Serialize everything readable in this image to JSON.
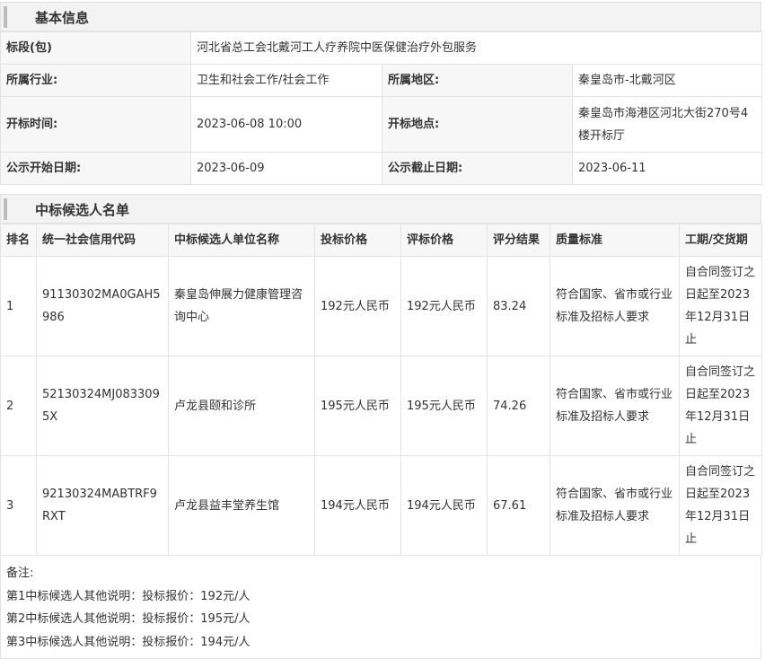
{
  "basic": {
    "title": "基本信息",
    "section_label": "标段(包)",
    "section_value": "河北省总工会北戴河工人疗养院中医保健治疗外包服务",
    "industry_label": "所属行业:",
    "industry_value": "卫生和社会工作/社会工作",
    "region_label": "所属地区:",
    "region_value": "秦皇岛市-北戴河区",
    "open_time_label": "开标时间:",
    "open_time_value": "2023-06-08 10:00",
    "open_place_label": "开标地点:",
    "open_place_value": "秦皇岛市海港区河北大街270号4楼开标厅",
    "pub_start_label": "公示开始日期:",
    "pub_start_value": "2023-06-09",
    "pub_end_label": "公示截止日期:",
    "pub_end_value": "2023-06-11"
  },
  "candidates": {
    "title": "中标候选人名单",
    "headers": {
      "rank": "排名",
      "code": "统一社会信用代码",
      "name": "中标候选人单位名称",
      "bid": "投标价格",
      "eval": "评标价格",
      "score": "评分结果",
      "quality": "质量标准",
      "period": "工期/交货期"
    },
    "rows": [
      {
        "rank": "1",
        "code": "91130302MA0GAH5986",
        "name": "秦皇岛伸展力健康管理咨询中心",
        "bid": "192元人民币",
        "eval": "192元人民币",
        "score": "83.24",
        "quality": "符合国家、省市或行业标准及招标人要求",
        "period": "自合同签订之日起至2023年12月31日止"
      },
      {
        "rank": "2",
        "code": "52130324MJ0833095X",
        "name": "卢龙县颐和诊所",
        "bid": "195元人民币",
        "eval": "195元人民币",
        "score": "74.26",
        "quality": "符合国家、省市或行业标准及招标人要求",
        "period": "自合同签订之日起至2023年12月31日止"
      },
      {
        "rank": "3",
        "code": "92130324MABTRF9RXT",
        "name": "卢龙县益丰堂养生馆",
        "bid": "194元人民币",
        "eval": "194元人民币",
        "score": "67.61",
        "quality": "符合国家、省市或行业标准及招标人要求",
        "period": "自合同签订之日起至2023年12月31日止"
      }
    ]
  },
  "notes": {
    "label": "备注:",
    "lines": [
      "第1中标候选人其他说明：投标报价：192元/人",
      "第2中标候选人其他说明：投标报价：195元/人",
      "第3中标候选人其他说明：投标报价：194元/人"
    ]
  }
}
